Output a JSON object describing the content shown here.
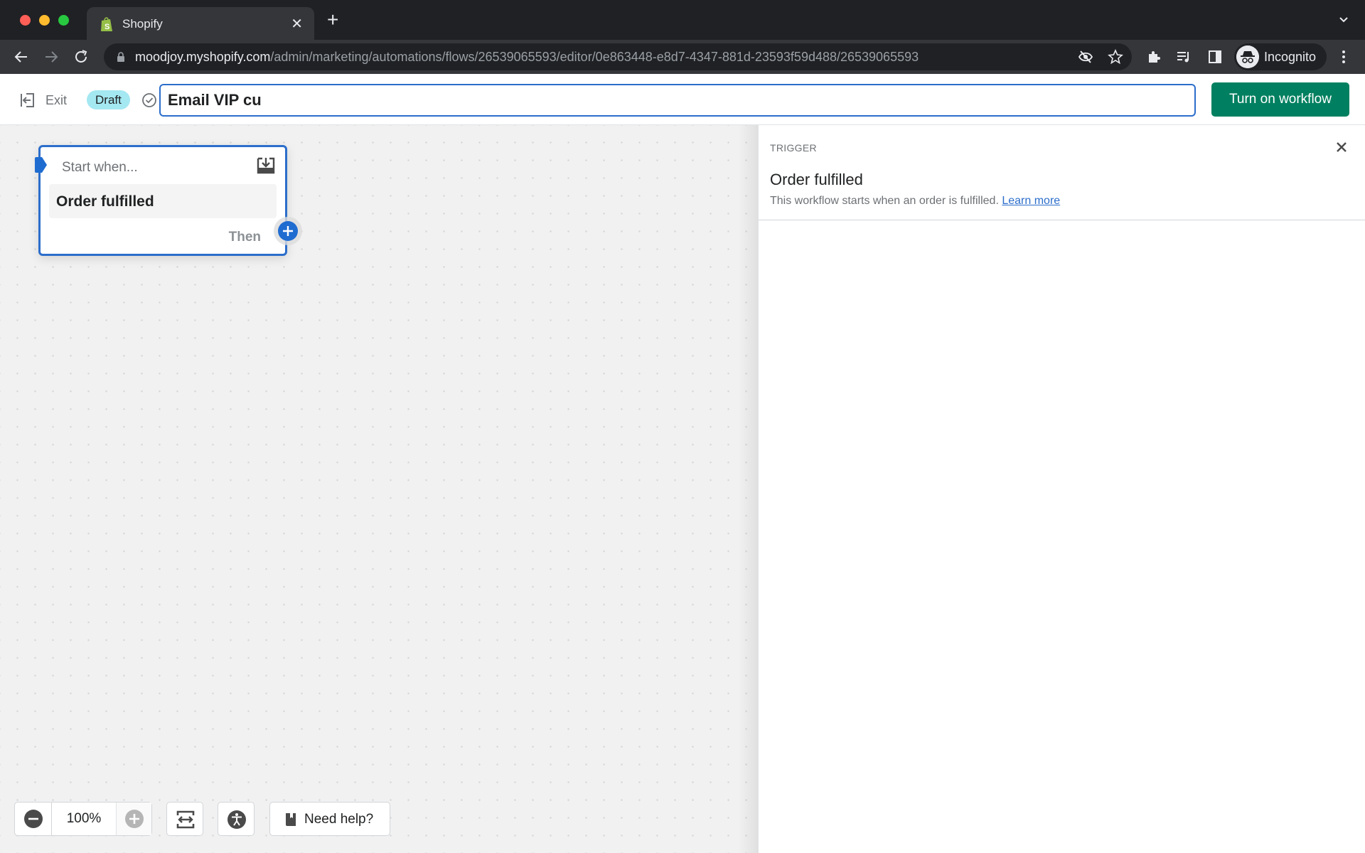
{
  "browser": {
    "tab_title": "Shopify",
    "url_host": "moodjoy.myshopify.com",
    "url_path": "/admin/marketing/automations/flows/26539065593/editor/0e863448-e8d7-4347-881d-23593f59d488/26539065593",
    "profile_label": "Incognito"
  },
  "header": {
    "exit_label": "Exit",
    "status_badge": "Draft",
    "workflow_name_value": "Email VIP cu",
    "primary_action": "Turn on workflow",
    "colors": {
      "primary": "#008060",
      "focus": "#2c6ecb",
      "badge": "#a4e8f2"
    }
  },
  "canvas": {
    "trigger_node": {
      "heading": "Start when...",
      "event": "Order fulfilled",
      "then_label": "Then"
    },
    "controls": {
      "zoom_level": "100%",
      "help_label": "Need help?"
    }
  },
  "panel": {
    "eyebrow": "TRIGGER",
    "title": "Order fulfilled",
    "description": "This workflow starts when an order is fulfilled.",
    "link_label": "Learn more"
  }
}
